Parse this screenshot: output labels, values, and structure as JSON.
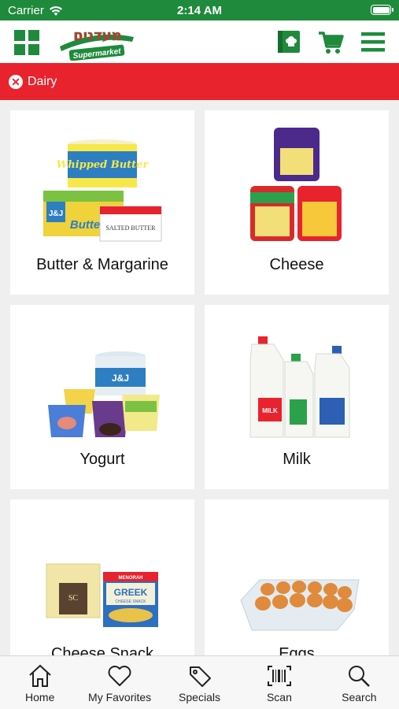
{
  "status_bar": {
    "carrier": "Carrier",
    "time": "2:14 AM"
  },
  "header": {
    "logo_text": "מעדנים",
    "logo_subtext": "Supermarket"
  },
  "breadcrumb": {
    "category": "Dairy"
  },
  "categories": [
    {
      "label": "Butter & Margarine"
    },
    {
      "label": "Cheese"
    },
    {
      "label": "Yogurt"
    },
    {
      "label": "Milk"
    },
    {
      "label": "Cheese Snack"
    },
    {
      "label": "Eggs"
    }
  ],
  "product_text": {
    "whipped": "Whipped Butter",
    "jj": "J&J",
    "butter": "Butter",
    "salted": "SALTED BUTTER",
    "menorah": "MENORAH",
    "greek": "GREEK",
    "greek_sub": "CHEESE SNACK",
    "sc": "SC",
    "milk": "MILK"
  },
  "tabs": [
    {
      "label": "Home"
    },
    {
      "label": "My Favorites"
    },
    {
      "label": "Specials"
    },
    {
      "label": "Scan"
    },
    {
      "label": "Search"
    }
  ],
  "colors": {
    "brand_green": "#1f8a3c",
    "category_red": "#e8232e"
  }
}
